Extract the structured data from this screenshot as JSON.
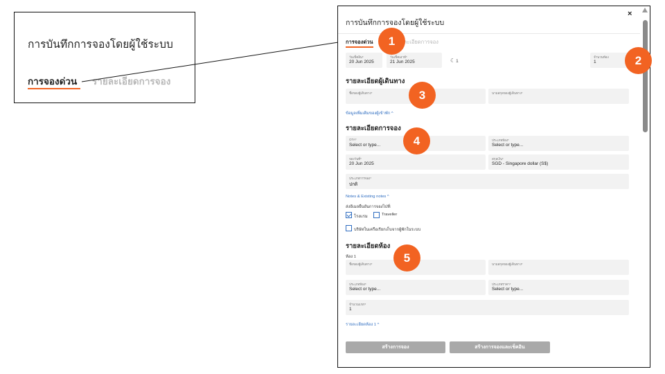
{
  "zoom": {
    "title": "การบันทึกการจองโดยผู้ใช้ระบบ",
    "tab_active": "การจองด่วน",
    "tab_faded": "รายละเอียดการจอง"
  },
  "modal": {
    "title": "การบันทึกการจองโดยผู้ใช้ระบบ",
    "close_icon": "×",
    "tabs": {
      "active": "การจองด่วน",
      "inactive": "รายละเอียดการจอง"
    },
    "dates": {
      "checkin_label": "วันเช็คอิน*",
      "checkin_value": "20 Jun 2025",
      "checkout_label": "วันเช็คเอาท์*",
      "checkout_value": "21 Jun 2025",
      "nights": "1",
      "rooms_label": "จำนวนห้อง",
      "rooms_value": "1"
    },
    "traveller": {
      "title": "รายละเอียดผู้เดินทาง",
      "first_name_label": "ชื่อของผู้เดินทาง*",
      "last_name_label": "นามสกุลของผู้เดินทาง*",
      "more_link": "ข้อมูลเพิ่มเติมของผู้เข้าพัก ^"
    },
    "booking": {
      "title": "รายละเอียดการจอง",
      "ota_label": "OTA*",
      "ota_value": "Select or type...",
      "room_type_label": "ประเภทห้อง*",
      "room_type_value": "Select or type...",
      "booking_date_label": "จองวันที่*",
      "booking_date_value": "20 Jun 2025",
      "currency_label": "สกุลเงิน*",
      "currency_value": "SGD - Singapore dollar (S$)",
      "booking_type_label": "ประเภทการจอง*",
      "booking_type_value": "ปกติ",
      "notes_link": "Notes & Existing notes ^",
      "send_label": "ส่งอีเมลยืนยันการจองไปที่:",
      "cb_hotel": "โรงแรม",
      "cb_traveller": "Traveller",
      "cb_tax": "บริษัทในเครือเรียกเก็บจากผู้พักในระบบ"
    },
    "room": {
      "title": "รายละเอียดห้อง",
      "room_no": "ห้อง 1",
      "first_name_label": "ชื่อของผู้เดินทาง*",
      "last_name_label": "นามสกุลของผู้เดินทาง*",
      "room_type_label": "ประเภทห้อง*",
      "room_type_value": "Select or type...",
      "rate_label": "ประเภทราคา*",
      "rate_value": "Select or type...",
      "guests_label": "จำนวนแขก*",
      "guests_value": "1",
      "detail_link": "รายละเอียดห้อง 1 ^"
    },
    "buttons": {
      "create": "สร้างการจอง",
      "create_checkin": "สร้างการจองและเช็คอิน"
    }
  },
  "badges": [
    "1",
    "2",
    "3",
    "4",
    "5"
  ],
  "colors": {
    "accent": "#f26322",
    "link": "#2d6cc0",
    "button_disabled": "#a9a9a9",
    "field_bg": "#f2f2f2"
  },
  "icons": {
    "moon": "moon-icon",
    "close": "close-icon",
    "check": "check-icon",
    "scroll_up": "scroll-up-icon"
  }
}
